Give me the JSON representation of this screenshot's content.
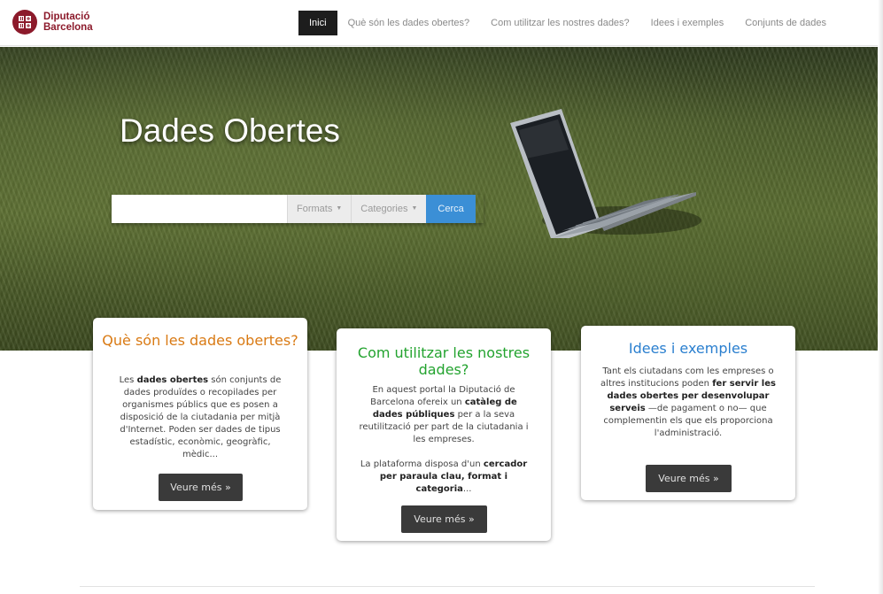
{
  "header": {
    "logo_line1": "Diputació",
    "logo_line2": "Barcelona",
    "brand_color": "#8c1a2b",
    "nav": [
      {
        "label": "Inici",
        "active": true
      },
      {
        "label": "Què són les dades obertes?",
        "active": false
      },
      {
        "label": "Com utilitzar les nostres dades?",
        "active": false
      },
      {
        "label": "Idees i exemples",
        "active": false
      },
      {
        "label": "Conjunts de dades",
        "active": false
      }
    ]
  },
  "hero": {
    "title": "Dades Obertes",
    "search": {
      "placeholder": "",
      "formats_label": "Formats",
      "categories_label": "Categories",
      "button_label": "Cerca",
      "button_color": "#3b8fd6"
    }
  },
  "cards": {
    "what": {
      "title": "Què són les dades obertes?",
      "title_color": "#d97a14",
      "text_before": "Les ",
      "text_bold": "dades obertes",
      "text_after": " són conjunts de dades produïdes o recopilades per organismes públics que es posen a disposició de la ciutadania per mitjà d'Internet. Poden ser dades de tipus estadístic, econòmic, geogràfic, mèdic...",
      "button": "Veure més »"
    },
    "how": {
      "title": "Com utilitzar les nostres dades?",
      "title_color": "#23a32f",
      "p1_a": "En aquest portal la Diputació de Barcelona ofereix un ",
      "p1_b": "catàleg de dades públiques",
      "p1_c": " per a la seva reutilització per part de la ciutadania i les empreses.",
      "p2_a": "La plataforma disposa d'un ",
      "p2_b": "cercador per paraula clau, format i categoria",
      "p2_c": "...",
      "button": "Veure més »"
    },
    "ideas": {
      "title": "Idees i exemples",
      "title_color": "#2a7fcf",
      "text_a": "Tant els ciutadans com les empreses o altres institucions poden ",
      "text_b": "fer servir les dades obertes per desenvolupar serveis",
      "text_c": " —de pagament o no— que complementin els que els proporciona l'administració.",
      "button": "Veure més »"
    }
  }
}
